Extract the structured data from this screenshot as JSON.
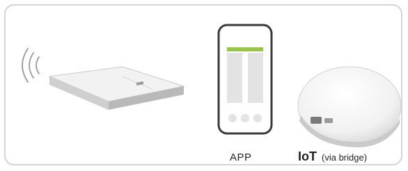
{
  "labels": {
    "app": "APP",
    "iot_main": "IoT",
    "iot_sub": "(via bridge)"
  },
  "icons": {
    "remote": "remote-control-icon",
    "signal": "wireless-signal-icon",
    "phone": "smartphone-icon",
    "bridge": "bridge-hub-icon"
  },
  "colors": {
    "phone_screen_bar": "#9bc44c",
    "phone_frame": "#3a3a3a",
    "card_border": "#d4d4d4"
  }
}
